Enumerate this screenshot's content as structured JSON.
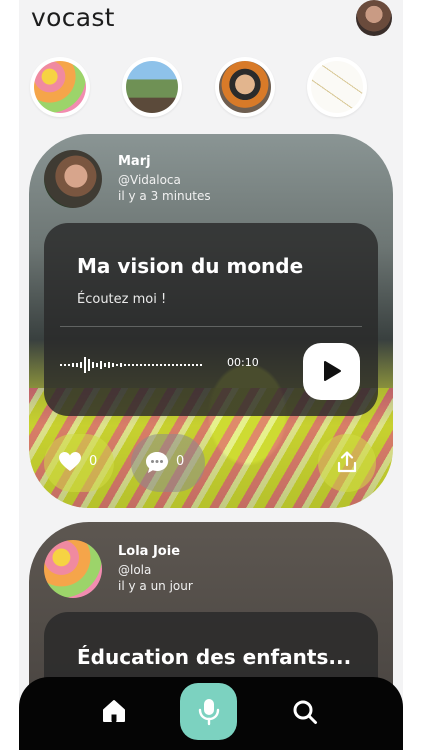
{
  "app": {
    "logo": "vocast"
  },
  "header": {
    "avatar_icon": "user-avatar"
  },
  "stories": [
    {
      "name": "story-1"
    },
    {
      "name": "story-2"
    },
    {
      "name": "story-3"
    },
    {
      "name": "story-4"
    }
  ],
  "posts": [
    {
      "author": "Marj",
      "handle": "@Vidaloca",
      "time": "il y a 3 minutes",
      "title": "Ma vision du monde",
      "subtitle": "Écoutez moi !",
      "duration": "00:10",
      "likes": "0",
      "comments": "0"
    },
    {
      "author": "Lola Joie",
      "handle": "@lola",
      "time": "il y a un jour",
      "title": "Éducation des enfants..."
    }
  ],
  "nav": {
    "items": [
      "home-icon",
      "microphone-icon",
      "search-icon"
    ],
    "accent": "#7cd2c0"
  },
  "colors": {
    "background": "#f3f3f4",
    "nav": "#050505"
  }
}
